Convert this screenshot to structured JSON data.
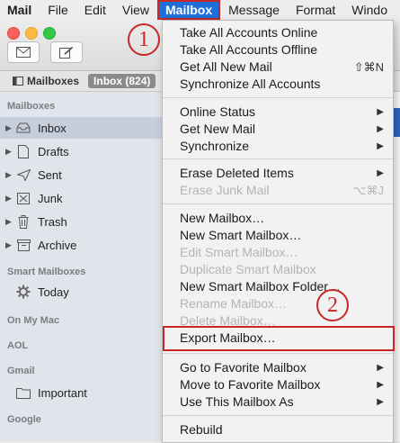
{
  "menubar": {
    "app": "Mail",
    "items": [
      "File",
      "Edit",
      "View",
      "Mailbox",
      "Message",
      "Format",
      "Windo"
    ],
    "active": "Mailbox"
  },
  "favorites_bar": {
    "mailboxes_label": "Mailboxes",
    "inbox_pill": "Inbox (824)"
  },
  "sidebar": {
    "sections": {
      "mailboxes": "Mailboxes",
      "smart": "Smart Mailboxes",
      "onmymac": "On My Mac",
      "aol": "AOL",
      "gmail": "Gmail",
      "google": "Google"
    },
    "items": [
      {
        "label": "Inbox",
        "icon": "inbox-icon",
        "selected": true
      },
      {
        "label": "Drafts",
        "icon": "drafts-icon"
      },
      {
        "label": "Sent",
        "icon": "sent-icon"
      },
      {
        "label": "Junk",
        "icon": "junk-icon"
      },
      {
        "label": "Trash",
        "icon": "trash-icon"
      },
      {
        "label": "Archive",
        "icon": "archive-icon"
      },
      {
        "label": "Today",
        "icon": "gear-icon"
      },
      {
        "label": "Important",
        "icon": "folder-icon"
      }
    ]
  },
  "menu": {
    "items": [
      {
        "label": "Take All Accounts Online"
      },
      {
        "label": "Take All Accounts Offline"
      },
      {
        "label": "Get All New Mail",
        "shortcut": "⇧⌘N"
      },
      {
        "label": "Synchronize All Accounts"
      },
      {
        "label": "Online Status",
        "submenu": true
      },
      {
        "label": "Get New Mail",
        "submenu": true
      },
      {
        "label": "Synchronize",
        "submenu": true
      },
      {
        "label": "Erase Deleted Items",
        "submenu": true
      },
      {
        "label": "Erase Junk Mail",
        "shortcut": "⌥⌘J",
        "disabled": true
      },
      {
        "label": "New Mailbox…"
      },
      {
        "label": "New Smart Mailbox…"
      },
      {
        "label": "Edit Smart Mailbox…",
        "disabled": true
      },
      {
        "label": "Duplicate Smart Mailbox",
        "disabled": true
      },
      {
        "label": "New Smart Mailbox Folder…"
      },
      {
        "label": "Rename Mailbox…",
        "disabled": true
      },
      {
        "label": "Delete Mailbox…",
        "disabled": true
      },
      {
        "label": "Export Mailbox…",
        "highlighted": true
      },
      {
        "label": "Go to Favorite Mailbox",
        "submenu": true
      },
      {
        "label": "Move to Favorite Mailbox",
        "submenu": true
      },
      {
        "label": "Use This Mailbox As",
        "submenu": true
      },
      {
        "label": "Rebuild"
      }
    ]
  },
  "callouts": [
    "1",
    "2"
  ],
  "colors": {
    "highlight_red": "#c62828",
    "menubar_active": "#1f6fd8"
  }
}
